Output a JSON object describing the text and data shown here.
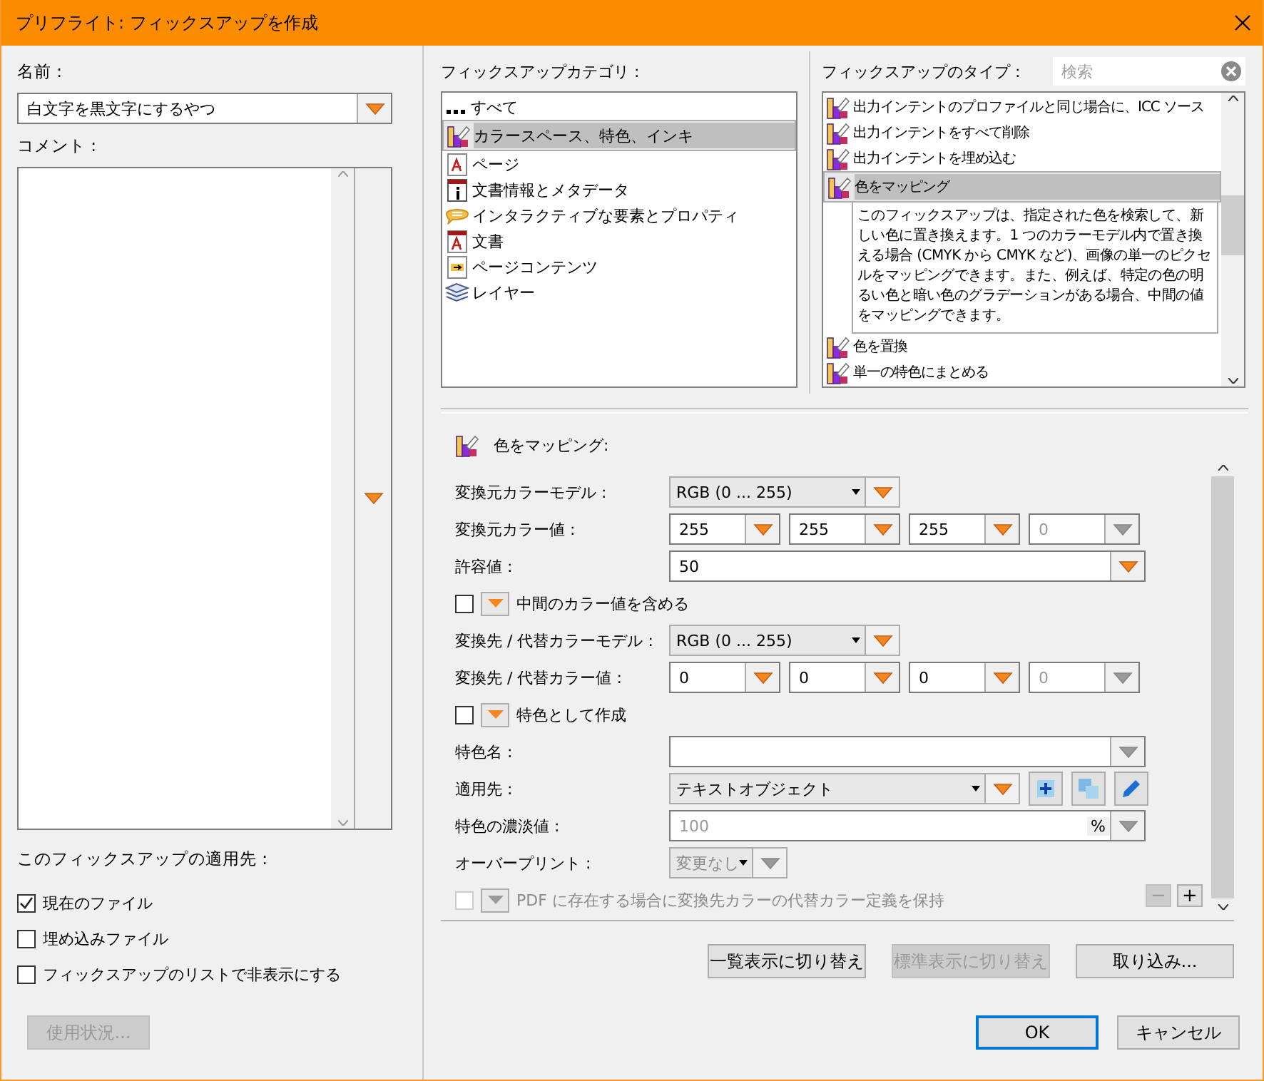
{
  "window": {
    "title": "プリフライト: フィックスアップを作成"
  },
  "name": {
    "label": "名前 :",
    "value": "白文字を黒文字にするやつ"
  },
  "comment": {
    "label": "コメント :"
  },
  "applies_to": {
    "label": "このフィックスアップの適用先 :",
    "options": [
      {
        "label": "現在のファイル",
        "checked": true
      },
      {
        "label": "埋め込みファイル",
        "checked": false
      },
      {
        "label": "フィックスアップのリストで非表示にする",
        "checked": false
      }
    ]
  },
  "usage_button": {
    "label": "使用状況...",
    "disabled": true
  },
  "categories": {
    "label": "フィックスアップカテゴリ :",
    "items": [
      {
        "label": "すべて",
        "kind": "all",
        "selected": false
      },
      {
        "label": "カラースペース、特色、インキ",
        "kind": "color",
        "selected": true
      },
      {
        "label": "ページ",
        "kind": "page",
        "selected": false
      },
      {
        "label": "文書情報とメタデータ",
        "kind": "info",
        "selected": false
      },
      {
        "label": "インタラクティブな要素とプロパティ",
        "kind": "interactive",
        "selected": false
      },
      {
        "label": "文書",
        "kind": "document",
        "selected": false
      },
      {
        "label": "ページコンテンツ",
        "kind": "content",
        "selected": false
      },
      {
        "label": "レイヤー",
        "kind": "layers",
        "selected": false
      }
    ]
  },
  "types": {
    "label": "フィックスアップのタイプ :",
    "search": {
      "placeholder": "検索"
    },
    "items": [
      {
        "label": "出力インテントのプロファイルと同じ場合に、ICC ソース",
        "selected": false
      },
      {
        "label": "出力インテントをすべて削除",
        "selected": false
      },
      {
        "label": "出力インテントを埋め込む",
        "selected": false
      },
      {
        "label": "色をマッピング",
        "selected": true,
        "description": "このフィックスアップは、指定された色を検索して、新しい色に置き換えます。1 つのカラーモデル内で置き換える場合 (CMYK から CMYK など)、画像の単一のピクセルをマッピングできます。また、例えば、特定の色の明るい色と暗い色のグラデーションがある場合、中間の値をマッピングできます。"
      },
      {
        "label": "色を置換",
        "selected": false
      },
      {
        "label": "単一の特色にまとめる",
        "selected": false
      }
    ]
  },
  "form": {
    "heading": "色をマッピング:",
    "rows": [
      {
        "kind": "select",
        "label": "変換元カラーモデル :",
        "value": "RGB (0 ... 255)"
      },
      {
        "kind": "values",
        "label": "変換元カラー値 :",
        "values": [
          {
            "value": "255",
            "disabled": false
          },
          {
            "value": "255",
            "disabled": false
          },
          {
            "value": "255",
            "disabled": false
          },
          {
            "value": "0",
            "disabled": true
          }
        ]
      },
      {
        "kind": "number",
        "label": "許容値 :",
        "value": "50"
      },
      {
        "kind": "check",
        "label": "中間のカラー値を含める",
        "checked": false,
        "disabled": false
      },
      {
        "kind": "select",
        "label": "変換先 / 代替カラーモデル :",
        "value": "RGB (0 ... 255)"
      },
      {
        "kind": "values",
        "label": "変換先 / 代替カラー値 :",
        "values": [
          {
            "value": "0",
            "disabled": false
          },
          {
            "value": "0",
            "disabled": false
          },
          {
            "value": "0",
            "disabled": false
          },
          {
            "value": "0",
            "disabled": true
          }
        ]
      },
      {
        "kind": "check",
        "label": "特色として作成",
        "checked": false,
        "disabled": false
      },
      {
        "kind": "combo",
        "label": "特色名 :"
      },
      {
        "kind": "target",
        "label": "適用先 :",
        "value": "テキストオブジェクト"
      },
      {
        "kind": "percent",
        "label": "特色の濃淡値 :",
        "value": "100",
        "unit": "%"
      },
      {
        "kind": "overprint",
        "label": "オーバープリント :",
        "value": "変更なし"
      },
      {
        "kind": "check",
        "label": "PDF に存在する場合に変換先カラーの代替カラー定義を保持",
        "checked": false,
        "disabled": true
      }
    ],
    "steppers": [
      {
        "label": "−",
        "disabled": true
      },
      {
        "label": "+",
        "disabled": false
      }
    ]
  },
  "view_buttons": [
    {
      "label": "一覧表示に切り替え",
      "disabled": false
    },
    {
      "label": "標準表示に切り替え",
      "disabled": true
    },
    {
      "label": "取り込み...",
      "disabled": false
    }
  ],
  "dialog_buttons": [
    {
      "label": "OK",
      "default": true
    },
    {
      "label": "キャンセル",
      "default": false
    }
  ]
}
